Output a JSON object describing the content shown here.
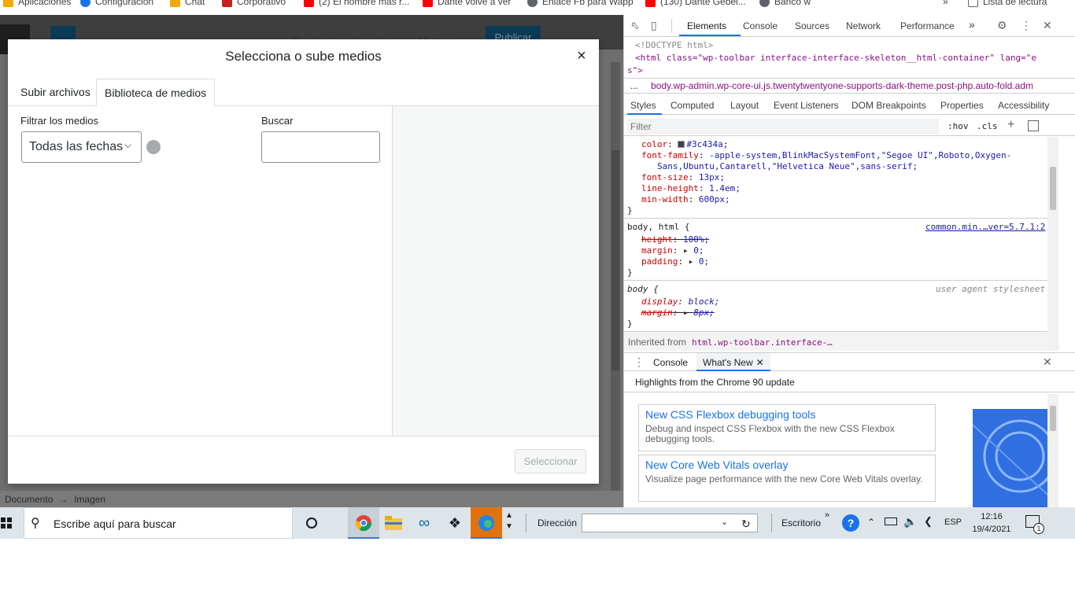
{
  "bookmarks": {
    "items": [
      {
        "label": "Aplicaciones",
        "color": "#f2a900"
      },
      {
        "label": "Configuración",
        "color": "#1a73e8"
      },
      {
        "label": "Chat",
        "color": "#f2a900"
      },
      {
        "label": "Corporativo",
        "color": "#c5221f"
      },
      {
        "label": "(2) El hombre más r...",
        "color": "#ff0000"
      },
      {
        "label": "Dante volvé a ver",
        "color": "#ff0000"
      },
      {
        "label": "Enlace Fb para Wapp",
        "color": "#5f6368"
      },
      {
        "label": "(130) Dante Gebel...",
        "color": "#ff0000"
      },
      {
        "label": "Banco w",
        "color": "#5f6368"
      }
    ],
    "more": "»",
    "reading_list": "Lista de lectura"
  },
  "wp_editor": {
    "publish_label": "Publicar",
    "save_draft_label": "Guardar como borrador",
    "preview_label": "Vista previa",
    "footer_breadcrumb": [
      "Documento",
      "→",
      "Imagen"
    ]
  },
  "media_modal": {
    "title": "Selecciona o sube medios",
    "close_glyph": "×",
    "tabs": [
      "Subir archivos",
      "Biblioteca de medios"
    ],
    "active_tab_index": 1,
    "filter_label": "Filtrar los medios",
    "date_filter_value": "Todas las fechas",
    "search_label": "Buscar",
    "search_value": "",
    "select_button_label": "Seleccionar"
  },
  "devtools": {
    "tabs": [
      "Elements",
      "Console",
      "Sources",
      "Network",
      "Performance"
    ],
    "active_tab": "Elements",
    "overflow_glyph": "»",
    "dom_lines": [
      "<!DOCTYPE html>",
      "<html class=\"wp-toolbar interface-interface-skeleton__html-container\" lang=\"e",
      "s\">"
    ],
    "breadcrumb": "body.wp-admin.wp-core-ui.js.twentytwentyone-supports-dark-theme.post-php.auto-fold.adm",
    "breadcrumb_prefix": "...",
    "styles_tabs": [
      "Styles",
      "Computed",
      "Layout",
      "Event Listeners",
      "DOM Breakpoints",
      "Properties",
      "Accessibility"
    ],
    "filter_placeholder": "Filter",
    "hov_label": ":hov",
    "cls_label": ".cls",
    "rule1": {
      "color_prop": "color",
      "color_value": "#3c434a",
      "color_swatch": "#3c434a",
      "ff_prop": "font-family",
      "ff_value_1": "-apple-system,BlinkMacSystemFont,\"Segoe UI\",Roboto,Oxygen-",
      "ff_value_2": "Sans,Ubuntu,Cantarell,\"Helvetica Neue\",sans-serif;",
      "fs_prop": "font-size",
      "fs_value": "13px;",
      "lh_prop": "line-height",
      "lh_value": "1.4em;",
      "mw_prop": "min-width",
      "mw_value": "600px;"
    },
    "rule2": {
      "selector": "body, html {",
      "source": "common.min.…ver=5.7.1:2",
      "height_prop": "height",
      "height_value": "100%;",
      "margin_prop": "margin",
      "margin_value": "0;",
      "padding_prop": "padding",
      "padding_value": "0;"
    },
    "rule3": {
      "selector": "body {",
      "source": "user agent stylesheet",
      "display_prop": "display",
      "display_value": "block;",
      "margin_prop": "margin",
      "margin_value": "8px;"
    },
    "inherited_label": "Inherited from",
    "inherited_from": "html.wp-toolbar.interface-…",
    "drawer": {
      "tabs": [
        "Console",
        "What's New"
      ],
      "active_tab": "What's New",
      "header": "Highlights from the Chrome 90 update",
      "features": [
        {
          "title": "New CSS Flexbox debugging tools",
          "desc": "Debug and inspect CSS Flexbox with the new CSS Flexbox debugging tools."
        },
        {
          "title": "New Core Web Vitals overlay",
          "desc": "Visualize page performance with the new Core Web Vitals overlay."
        }
      ]
    }
  },
  "taskbar": {
    "search_placeholder": "Escribe aquí para buscar",
    "address_label": "Dirección",
    "desktop_label": "Escritorio",
    "language": "ESP",
    "time": "12:16",
    "date": "19/4/2021",
    "notification_count": "1"
  }
}
